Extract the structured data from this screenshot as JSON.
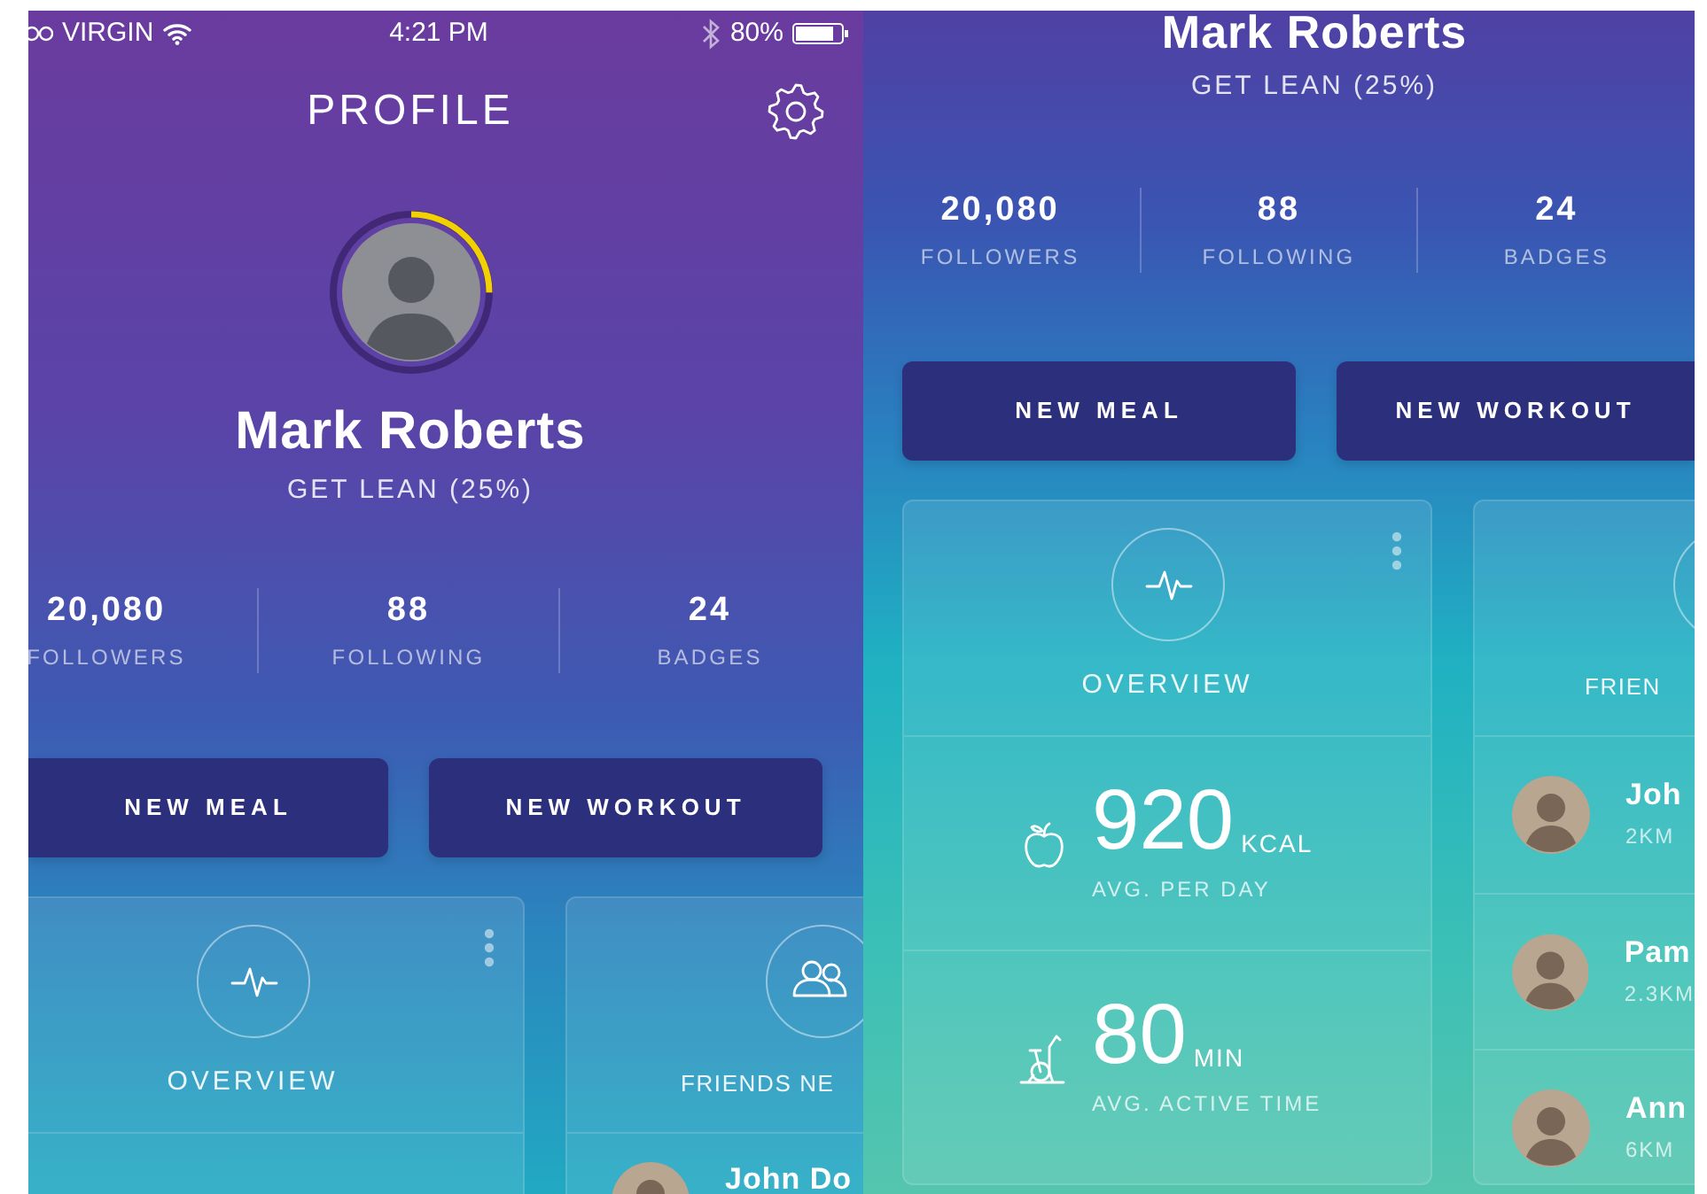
{
  "screens": [
    {
      "status_bar": {
        "carrier": "VIRGIN",
        "time": "4:21 PM",
        "battery": "80%"
      },
      "header": {
        "title": "PROFILE"
      },
      "profile": {
        "name": "Mark Roberts",
        "goal": "GET LEAN (25%)",
        "progress": {
          "level": 0.25
        }
      },
      "stats": [
        {
          "value": "20,080",
          "label": "FOLLOWERS"
        },
        {
          "value": "88",
          "label": "FOLLOWING"
        },
        {
          "value": "24",
          "label": "BADGES"
        }
      ],
      "actions": [
        "NEW MEAL",
        "NEW WORKOUT"
      ],
      "overview": {
        "title": "OVERVIEW"
      },
      "friends": {
        "title": "FRIENDS NE",
        "people": [
          {
            "name": "John Do"
          }
        ]
      }
    },
    {
      "profile": {
        "name": "Mark Roberts",
        "goal": "GET LEAN (25%)"
      },
      "stats": [
        {
          "value": "20,080",
          "label": "FOLLOWERS"
        },
        {
          "value": "88",
          "label": "FOLLOWING"
        },
        {
          "value": "24",
          "label": "BADGES"
        }
      ],
      "actions": [
        "NEW MEAL",
        "NEW WORKOUT"
      ],
      "overview": {
        "title": "OVERVIEW",
        "metrics": [
          {
            "kind": "calories",
            "value": "920",
            "unit": "KCAL",
            "caption": "AVG. PER DAY"
          },
          {
            "kind": "activity",
            "value": "80",
            "unit": "MIN",
            "caption": "AVG. ACTIVE TIME"
          }
        ]
      },
      "friends": {
        "title": "FRIEN",
        "people": [
          {
            "name": "Joh",
            "distance": "2KM"
          },
          {
            "name": "Pam",
            "distance": "2.3KM"
          },
          {
            "name": "Ann",
            "distance": "6KM"
          }
        ]
      }
    }
  ]
}
